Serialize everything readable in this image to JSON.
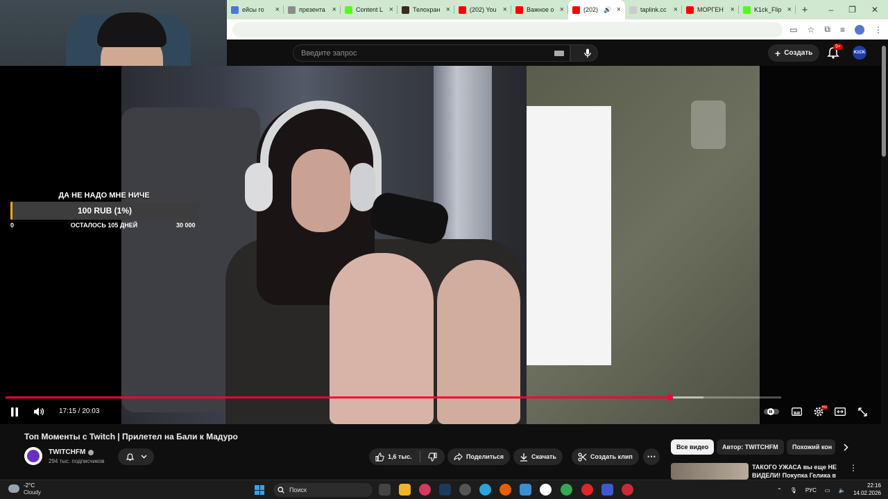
{
  "browser": {
    "tabs": [
      {
        "label": "ейсы го",
        "favicon_color": "#4a76d8"
      },
      {
        "label": "презента",
        "favicon_color": "#8c8c8c"
      },
      {
        "label": "Content L",
        "favicon_color": "#53fc18"
      },
      {
        "label": "Телохран",
        "favicon_color": "#3a2a1f"
      },
      {
        "label": "(202) You",
        "favicon_color": "#ff0000"
      },
      {
        "label": "Важное о",
        "favicon_color": "#ff0000"
      },
      {
        "label": "(202)",
        "favicon_color": "#ff0000",
        "active": true
      },
      {
        "label": "taplink.cc",
        "favicon_color": "#cccccc"
      },
      {
        "label": "МОРГЕН",
        "favicon_color": "#ff0000"
      },
      {
        "label": "K1ck_Flip",
        "favicon_color": "#53fc18"
      }
    ],
    "new_tab_glyph": "+",
    "window_controls": [
      "–",
      "❐",
      "✕"
    ]
  },
  "youtube": {
    "search_placeholder": "Введите запрос",
    "create_label": "Создать",
    "notifications_badge": "9+",
    "channel_logo_text": "K1CK"
  },
  "overlay": {
    "goal_title": "ДА НЕ НАДО МНЕ НИЧЕ",
    "goal_amount": "100 RUB (1%)",
    "goal_progress_fraction": 0.01,
    "goal_min": "0",
    "goal_remaining": "ОСТАЛОСЬ 105 ДНЕЙ",
    "goal_max": "30 000"
  },
  "player": {
    "time_display": "17:15 / 20:03",
    "played_fraction": 0.856,
    "buffered_fraction": 0.9,
    "controls": [
      "pause-icon",
      "volume-icon",
      "autoplay-toggle",
      "subtitles-icon",
      "settings-icon",
      "theater-icon",
      "fullscreen-icon"
    ],
    "settings_badge": "HD"
  },
  "video": {
    "title": "Топ Моменты с Twitch | Прилетел на Бали к Мадуро",
    "channel_name": "TWITCHFM",
    "subscribers": "294 тыс. подписчиков",
    "likes": "1,6 тыс.",
    "share_label": "Поделиться",
    "download_label": "Скачать",
    "clip_label": "Создать клип",
    "more_glyph": "⋯"
  },
  "sidebar": {
    "chips": [
      "Все видео",
      "Автор: TWITCHFM",
      "Похожий кон"
    ],
    "recommendation_title": "ТАКОГО УЖАСА вы еще НЕ ВИДЕЛИ! Покупка Гелика в",
    "more_glyph": "⋮"
  },
  "taskbar": {
    "temperature": "-2°C",
    "weather": "Cloudy",
    "search_label": "Поиск",
    "language": "РУС",
    "time": "22:16",
    "date": "14.02.2026",
    "apps": [
      {
        "name": "files-app",
        "color": "#f0b429"
      },
      {
        "name": "steam-app",
        "color": "#1b3a5c"
      },
      {
        "name": "edge-app",
        "color": "#2ba4d9"
      },
      {
        "name": "firefox-app",
        "color": "#e66000"
      },
      {
        "name": "yandex-app",
        "color": "#ffffff"
      },
      {
        "name": "chrome-app",
        "color": "#34a853"
      },
      {
        "name": "opera-app",
        "color": "#e0242b"
      }
    ]
  }
}
